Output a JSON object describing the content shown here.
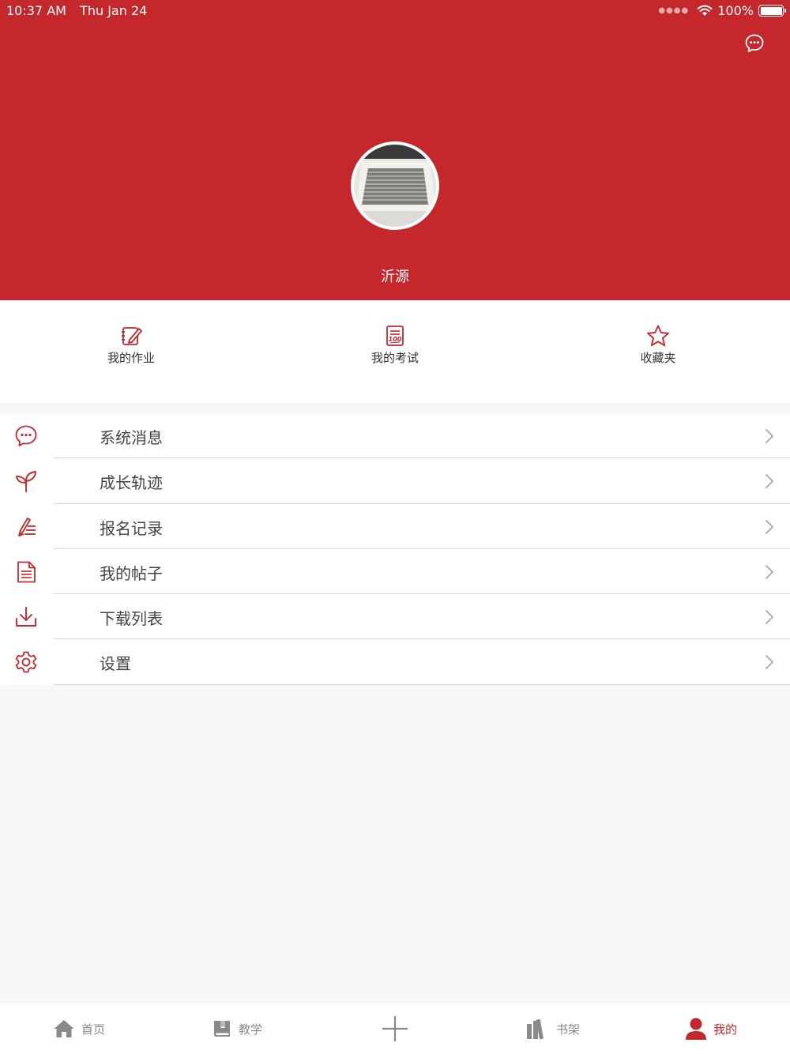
{
  "status_bar": {
    "time": "10:37 AM",
    "date": "Thu Jan 24",
    "battery": "100%",
    "battery_level": 1.0
  },
  "header": {
    "background_color": "#c4282c",
    "username": "沂源",
    "message_icon": "chat-bubble-icon"
  },
  "quick_actions": [
    {
      "label": "我的作业",
      "icon": "homework-edit-icon"
    },
    {
      "label": "我的考试",
      "icon": "exam-score-icon"
    },
    {
      "label": "收藏夹",
      "icon": "star-icon"
    }
  ],
  "menu": [
    {
      "label": "系统消息",
      "icon": "chat-bubble-icon"
    },
    {
      "label": "成长轨迹",
      "icon": "sprout-icon"
    },
    {
      "label": "报名记录",
      "icon": "pen-list-icon"
    },
    {
      "label": "我的帖子",
      "icon": "document-icon"
    },
    {
      "label": "下载列表",
      "icon": "download-icon"
    },
    {
      "label": "设置",
      "icon": "gear-icon"
    }
  ],
  "tabbar": [
    {
      "label": "首页",
      "icon": "home-icon",
      "active": false
    },
    {
      "label": "教学",
      "icon": "book-icon",
      "active": false
    },
    {
      "label": "",
      "icon": "plus-icon",
      "active": false
    },
    {
      "label": "书架",
      "icon": "bookshelf-icon",
      "active": false
    },
    {
      "label": "我的",
      "icon": "person-icon",
      "active": true
    }
  ],
  "colors": {
    "accent": "#c4282c",
    "menu_text": "#444444",
    "tab_inactive": "#888888",
    "background": "#f8f8f8"
  }
}
